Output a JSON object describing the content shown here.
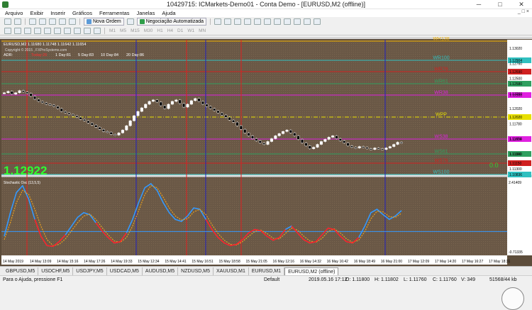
{
  "window": {
    "title": "10429715: ICMarkets-Demo01 - Conta Demo - [EURUSD,M2 (offline)]",
    "controls": [
      "─",
      "□",
      "✕"
    ]
  },
  "menu": [
    "Arquivo",
    "Exibir",
    "Inserir",
    "Gráficos",
    "Ferramentas",
    "Janelas",
    "Ajuda"
  ],
  "mdi_controls": "_ □ ×",
  "toolbar": {
    "new_order": "Nova Ordem",
    "auto_trading": "Negociação Automatizada",
    "timeframes": [
      "M1",
      "M5",
      "M15",
      "M30",
      "H1",
      "H4",
      "D1",
      "W1",
      "MN"
    ]
  },
  "chart": {
    "header": "EURUSD,M2  1.11680 1.11748 1.11642 1.11654",
    "copyright": "Copyright © 2015 , FXProSystems.com",
    "adr": {
      "label": "ADR:",
      "today": "Today:26",
      "d1": "1 Day:81",
      "d5": "5 Day:83",
      "d10": "10 Day:84",
      "d20": "20 Day:86"
    },
    "big_price": "1.12922",
    "zero_value": "0.0",
    "levels": [
      {
        "name": "WR138",
        "price": "",
        "color": "#f0b000"
      },
      {
        "name": "WR100",
        "price": "1.12904",
        "color": "#30c0c0"
      },
      {
        "name": "WR76",
        "price": "1.12690",
        "color": "#d02020"
      },
      {
        "name": "WR61",
        "price": "1.12580",
        "color": "#30a060"
      },
      {
        "name": "WR38",
        "price": "1.12300",
        "color": "#e020e0"
      },
      {
        "name": "WPP",
        "price": "1.12020",
        "color": "#e8e000"
      },
      {
        "name": "WS38",
        "price": "1.11600",
        "color": "#e020e0"
      },
      {
        "name": "WS61",
        "price": "1.11200",
        "color": "#30a060"
      },
      {
        "name": "WS76",
        "price": "1.11150",
        "color": "#d02020"
      },
      {
        "name": "WS100",
        "price": "1.10836",
        "color": "#30c0c0"
      }
    ],
    "price_axis": [
      "1.13020",
      "1.12760",
      "1.12500",
      "1.12260",
      "1.12020",
      "1.11780",
      "1.11654",
      "1.11540",
      "1.11300"
    ],
    "time_axis": [
      "14 May 2019",
      "14 May 13:09",
      "14 May 15:16",
      "14 May 17:26",
      "14 May 19:33",
      "15 May 12:34",
      "15 May 14:41",
      "15 May 16:51",
      "15 May 18:58",
      "15 May 21:05",
      "16 May 12:16",
      "16 May 14:32",
      "16 May 16:42",
      "16 May 18:49",
      "16 May 21:00",
      "17 May 12:09",
      "17 May 14:20",
      "17 May 16:27",
      "17 May 18:31"
    ],
    "indicator": {
      "label": "Stochastic Osc (13,5,5)",
      "axis_top": "2.41409",
      "axis_bottom": "-0.71335"
    }
  },
  "chart_data": {
    "type": "candlestick",
    "prices": [
      1.1244,
      1.1246,
      1.1242,
      1.1244,
      1.1247,
      1.1245,
      1.1243,
      1.1239,
      1.1235,
      1.1232,
      1.123,
      1.1228,
      1.1227,
      1.1225,
      1.1222,
      1.1218,
      1.1216,
      1.1214,
      1.1212,
      1.121,
      1.1207,
      1.1205,
      1.1202,
      1.1199,
      1.1196,
      1.1193,
      1.119,
      1.1189,
      1.1186,
      1.1185,
      1.1188,
      1.1192,
      1.1198,
      1.1205,
      1.1212,
      1.1218,
      1.1223,
      1.1228,
      1.1232,
      1.1234,
      1.1231,
      1.1226,
      1.1222,
      1.1228,
      1.1232,
      1.1234,
      1.1229,
      1.1224,
      1.1228,
      1.1233,
      1.1236,
      1.1232,
      1.1228,
      1.1225,
      1.1222,
      1.1219,
      1.1216,
      1.1213,
      1.121,
      1.1206,
      1.1203,
      1.1198,
      1.1193,
      1.1188,
      1.1184,
      1.118,
      1.1177,
      1.1174,
      1.1172,
      1.1176,
      1.118,
      1.1184,
      1.1187,
      1.119,
      1.1192,
      1.1188,
      1.1184,
      1.1179,
      1.1174,
      1.117,
      1.1166,
      1.1168,
      1.1172,
      1.1176,
      1.1179,
      1.1182,
      1.1184,
      1.118,
      1.1177,
      1.1174,
      1.117,
      1.1168,
      1.1167,
      1.1169,
      1.1168,
      1.1166,
      1.1165,
      1.1167,
      1.1166,
      1.1165,
      1.1167,
      1.1169,
      1.1172,
      1.1175,
      1.1174
    ],
    "ylim": [
      1.113,
      1.1318
    ],
    "stoch_main": [
      0.2,
      0.55,
      0.85,
      0.95,
      0.75,
      0.45,
      0.2,
      0.06,
      0.05,
      0.12,
      0.22,
      0.35,
      0.48,
      0.55,
      0.52,
      0.4,
      0.28,
      0.18,
      0.1,
      0.12,
      0.25,
      0.45,
      0.7,
      0.92,
      0.98,
      0.88,
      0.7,
      0.55,
      0.45,
      0.42,
      0.5,
      0.62,
      0.6,
      0.45,
      0.3,
      0.18,
      0.1,
      0.06,
      0.08,
      0.15,
      0.25,
      0.3,
      0.28,
      0.2,
      0.14,
      0.18,
      0.3,
      0.35,
      0.25,
      0.15,
      0.1,
      0.12,
      0.22,
      0.32,
      0.3,
      0.2,
      0.12,
      0.1,
      0.18,
      0.35,
      0.55,
      0.6,
      0.52,
      0.45,
      0.5,
      0.58
    ],
    "stoch_signal": [
      0.15,
      0.4,
      0.7,
      0.88,
      0.82,
      0.6,
      0.35,
      0.15,
      0.06,
      0.08,
      0.16,
      0.28,
      0.4,
      0.5,
      0.53,
      0.45,
      0.33,
      0.22,
      0.13,
      0.11,
      0.18,
      0.35,
      0.58,
      0.82,
      0.95,
      0.92,
      0.78,
      0.62,
      0.5,
      0.44,
      0.46,
      0.56,
      0.6,
      0.52,
      0.37,
      0.24,
      0.14,
      0.08,
      0.07,
      0.12,
      0.2,
      0.27,
      0.29,
      0.24,
      0.17,
      0.16,
      0.24,
      0.32,
      0.29,
      0.2,
      0.13,
      0.11,
      0.17,
      0.27,
      0.31,
      0.25,
      0.16,
      0.11,
      0.14,
      0.27,
      0.46,
      0.57,
      0.56,
      0.49,
      0.48,
      0.54
    ],
    "stoch_ylim": [
      -0.71335,
      2.41409
    ]
  },
  "tabs": [
    "GBPUSD,M5",
    "USDCHF,M5",
    "USDJPY,M5",
    "USDCAD,M5",
    "AUDUSD,M5",
    "NZDUSD,M5",
    "XAUUSD,M1",
    "EURUSD,M1",
    "EURUSD,M2 (offline)"
  ],
  "status": {
    "help": "Para o Ajuda, pressione F1",
    "profile": "Default",
    "datetime": "2019.05.16 17:12",
    "open": "O: 1.11800",
    "high": "H: 1.11802",
    "low": "L: 1.11760",
    "close": "C: 1.11760",
    "volume": "V: 349",
    "traffic": "51568/44 kb"
  },
  "colors": {
    "chart_bg": "#6b5a48",
    "bullish": "#ffffff",
    "bearish": "#000000",
    "stoch_main": "#3399ff",
    "stoch_signal": "#e8a020",
    "stoch_red": "#ff2020",
    "vline_red": "#e02020",
    "vline_blue": "#2020c0"
  }
}
